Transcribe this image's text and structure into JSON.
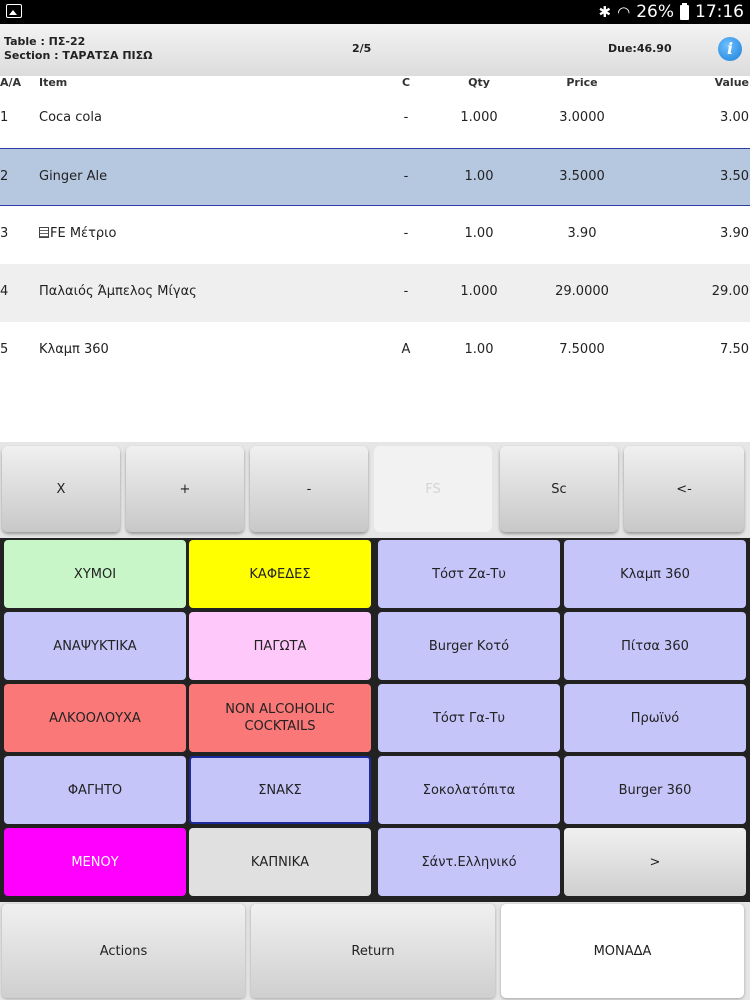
{
  "statusbar": {
    "icons": [
      "gallery-icon",
      "bluetooth-icon",
      "wifi-icon",
      "battery-icon"
    ],
    "battery": "26%",
    "time": "17:16"
  },
  "header": {
    "table_line": "Table : ΠΣ-22",
    "section_line": "Section : ΤΑΡΑΤΣΑ ΠΙΣΩ",
    "page": "2/5",
    "due": "Due:46.90",
    "info_glyph": "i"
  },
  "columns": {
    "aa": "A/A",
    "item": "Item",
    "c": "C",
    "qty": "Qty",
    "price": "Price",
    "value": "Value"
  },
  "rows": [
    {
      "aa": "1",
      "item": "Coca cola",
      "c": "-",
      "qty": "1.000",
      "price": "3.0000",
      "value": "3.00"
    },
    {
      "aa": "2",
      "item": "Ginger Ale",
      "c": "-",
      "qty": "1.00",
      "price": "3.5000",
      "value": "3.50"
    },
    {
      "aa": "3",
      "item": "FE Μέτριο",
      "c": "-",
      "qty": "1.00",
      "price": "3.90",
      "value": "3.90"
    },
    {
      "aa": "4",
      "item": "Παλαιός Άμπελος Μίγας",
      "c": "-",
      "qty": "1.000",
      "price": "29.0000",
      "value": "29.00"
    },
    {
      "aa": "5",
      "item": "Κλαμπ 360",
      "c": "A",
      "qty": "1.00",
      "price": "7.5000",
      "value": "7.50"
    }
  ],
  "keypad": [
    "X",
    "+",
    "-",
    "FS",
    "Sc",
    "<-"
  ],
  "categories": [
    {
      "label": "ΧΥΜΟΙ",
      "color": "#c8f6c8"
    },
    {
      "label": "ΚΑΦΕΔΕΣ",
      "color": "#ffff00"
    },
    {
      "label": "ΑΝΑΨΥΚΤΙΚΑ",
      "color": "#c5c5fa"
    },
    {
      "label": "ΠΑΓΩΤΑ",
      "color": "#ffc8fa"
    },
    {
      "label": "ΑΛΚΟΟΛΟΥΧΑ",
      "color": "#fa7878"
    },
    {
      "label": "NON ALCOHOLIC COCKTAILS",
      "color": "#fa7878"
    },
    {
      "label": "ΦΑΓΗΤΟ",
      "color": "#c5c5fa"
    },
    {
      "label": "ΣΝΑΚΣ",
      "color": "#c5c5fa"
    },
    {
      "label": "ΜΕΝΟΥ",
      "color": "#ff00ff"
    },
    {
      "label": "ΚΑΠΝΙΚΑ",
      "color": "#e0e0e0"
    }
  ],
  "products": [
    "Τόστ Ζα-Τυ",
    "Κλαμπ 360",
    "Burger Κοτό",
    "Πίτσα 360",
    "Τόστ Γα-Τυ",
    "Πρωϊνό",
    "Σοκολατόπιτα",
    "Burger 360",
    "Σάντ.Ελληνικό",
    ">"
  ],
  "footer": {
    "actions": "Actions",
    "return": "Return",
    "monada": "ΜΟΝΑΔΑ"
  }
}
